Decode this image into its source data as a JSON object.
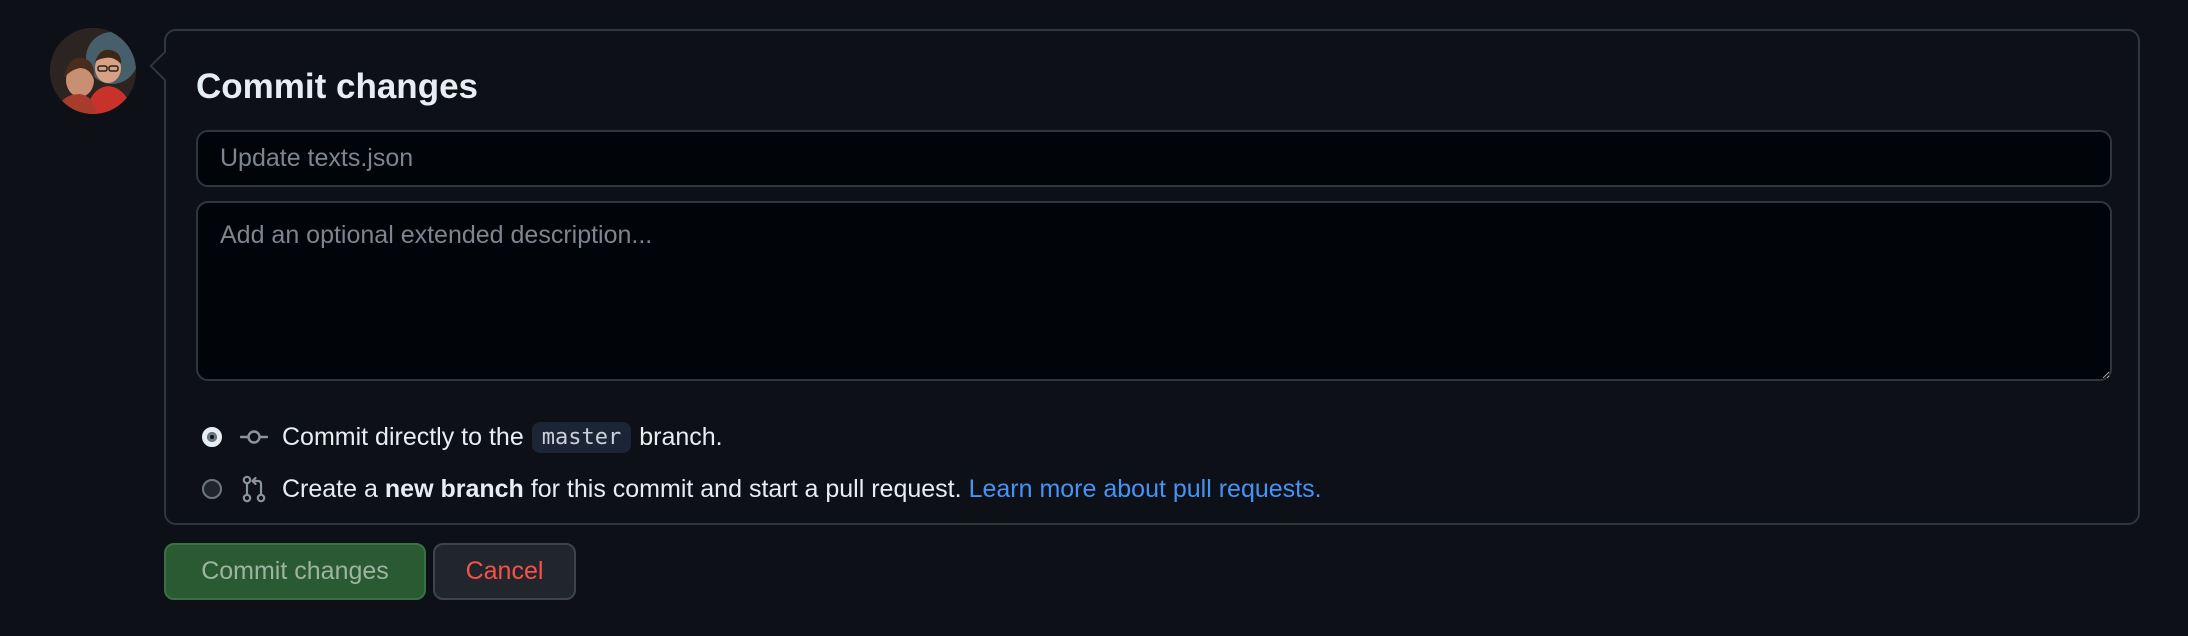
{
  "form": {
    "title": "Commit changes",
    "summary_placeholder": "Update texts.json",
    "description_placeholder": "Add an optional extended description..."
  },
  "options": {
    "direct": {
      "prefix": "Commit directly to the",
      "branch": "master",
      "suffix": "branch.",
      "selected": true
    },
    "new_branch": {
      "prefix": "Create a",
      "bold": "new branch",
      "suffix": "for this commit and start a pull request.",
      "link": "Learn more about pull requests.",
      "selected": false
    }
  },
  "buttons": {
    "commit": "Commit changes",
    "cancel": "Cancel"
  },
  "icons": {
    "direct": "git-commit-icon",
    "new_branch": "git-pull-request-icon"
  },
  "colors": {
    "background": "#0d1117",
    "link": "#4493f8",
    "commit_button": "#2a5a32",
    "cancel_text": "#f85149"
  }
}
